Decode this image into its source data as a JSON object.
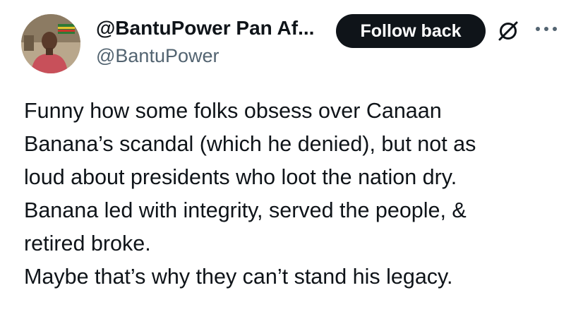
{
  "author": {
    "display_name": "@BantuPower Pan Af...",
    "handle": "@BantuPower",
    "avatar_icon": "profile-photo"
  },
  "actions": {
    "follow_label": "Follow back",
    "grok_icon": "grok-slash-circle-icon",
    "more_icon": "more-dots-icon"
  },
  "tweet": {
    "lines": [
      "Funny how some folks obsess over Canaan",
      "Banana’s scandal (which he denied), but not as",
      "loud about presidents who loot the nation dry.",
      "Banana led with integrity, served the people, &",
      "retired broke.",
      "Maybe that’s why they can’t stand his legacy."
    ]
  },
  "colors": {
    "text": "#0f1419",
    "secondary": "#536471",
    "button_bg": "#0f1419",
    "button_text": "#ffffff"
  }
}
